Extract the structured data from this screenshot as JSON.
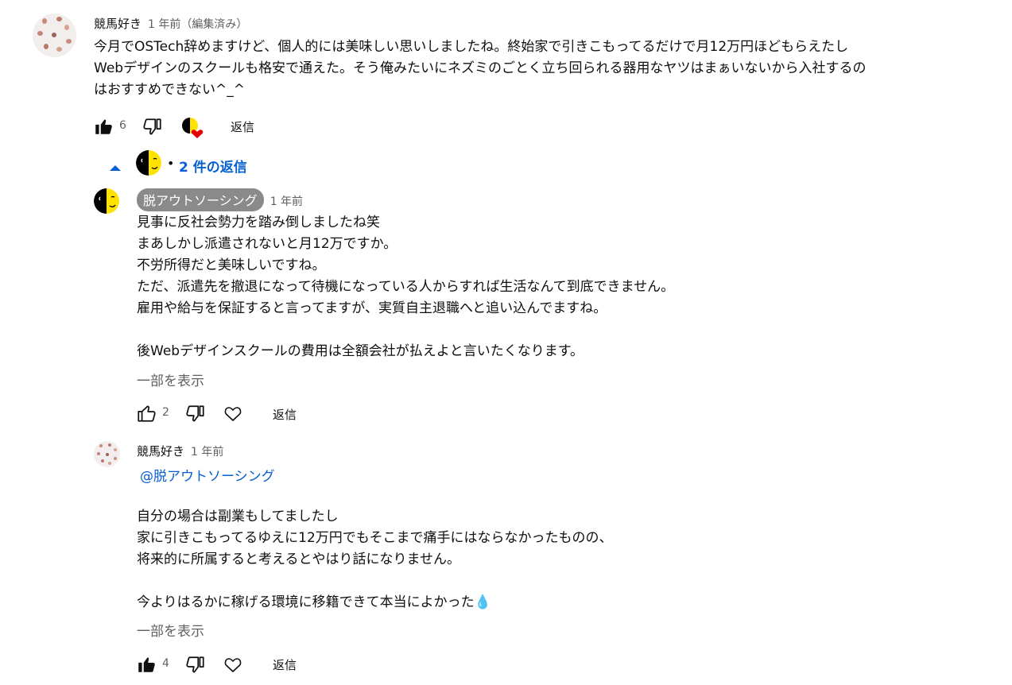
{
  "colors": {
    "link": "#065fd4",
    "chip_bg": "#8a8a8a",
    "muted": "#606060"
  },
  "top_comment": {
    "author": "競馬好き",
    "meta": "1 年前（編集済み）",
    "text": "今月でOSTech辞めますけど、個人的には美味しい思いしましたね。終始家で引きこもってるだけで月12万円ほどもらえたし\nWebデザインのスクールも格安で通えた。そう俺みたいにネズミのごとく立ち回られる器用なヤツはまぁいないから入社するの\nはおすすめできない^_^",
    "like_count": "6",
    "reply_label": "返信",
    "icons": [
      "thumbs-up-filled-icon",
      "thumbs-down-icon",
      "creator-heart-icon"
    ]
  },
  "replies_toggle": {
    "label": "2 件の返信",
    "icon": "chevron-up-icon"
  },
  "replies": [
    {
      "author": "脱アウトソーシング",
      "meta": "1 年前",
      "text": "見事に反社会勢力を踏み倒しましたね笑\nまあしかし派遣されないと月12万ですか。\n不労所得だと美味しいですね。\nただ、派遣先を撤退になって待機になっている人からすれば生活なんて到底できません。\n雇用や給与を保証すると言ってますが、実質自主退職へと追い込んでますね。\n\n後Webデザインスクールの費用は全額会社が払えよと言いたくなります。",
      "show_more": "一部を表示",
      "like_count": "2",
      "reply_label": "返信",
      "icons": [
        "thumbs-up-icon",
        "thumbs-down-icon",
        "heart-outline-icon"
      ]
    },
    {
      "author": "競馬好き",
      "meta": "1 年前",
      "mention": "@脱アウトソーシング",
      "text": "自分の場合は副業もしてましたし\n家に引きこもってるゆえに12万円でもそこまで痛手にはならなかったものの、\n将来的に所属すると考えるとやはり話になりません。\n\n今よりはるかに稼げる環境に移籍できて本当によかった",
      "emoji": "💧",
      "show_more": "一部を表示",
      "like_count": "4",
      "reply_label": "返信",
      "icons": [
        "thumbs-up-filled-icon",
        "thumbs-down-icon",
        "heart-outline-icon"
      ]
    }
  ]
}
